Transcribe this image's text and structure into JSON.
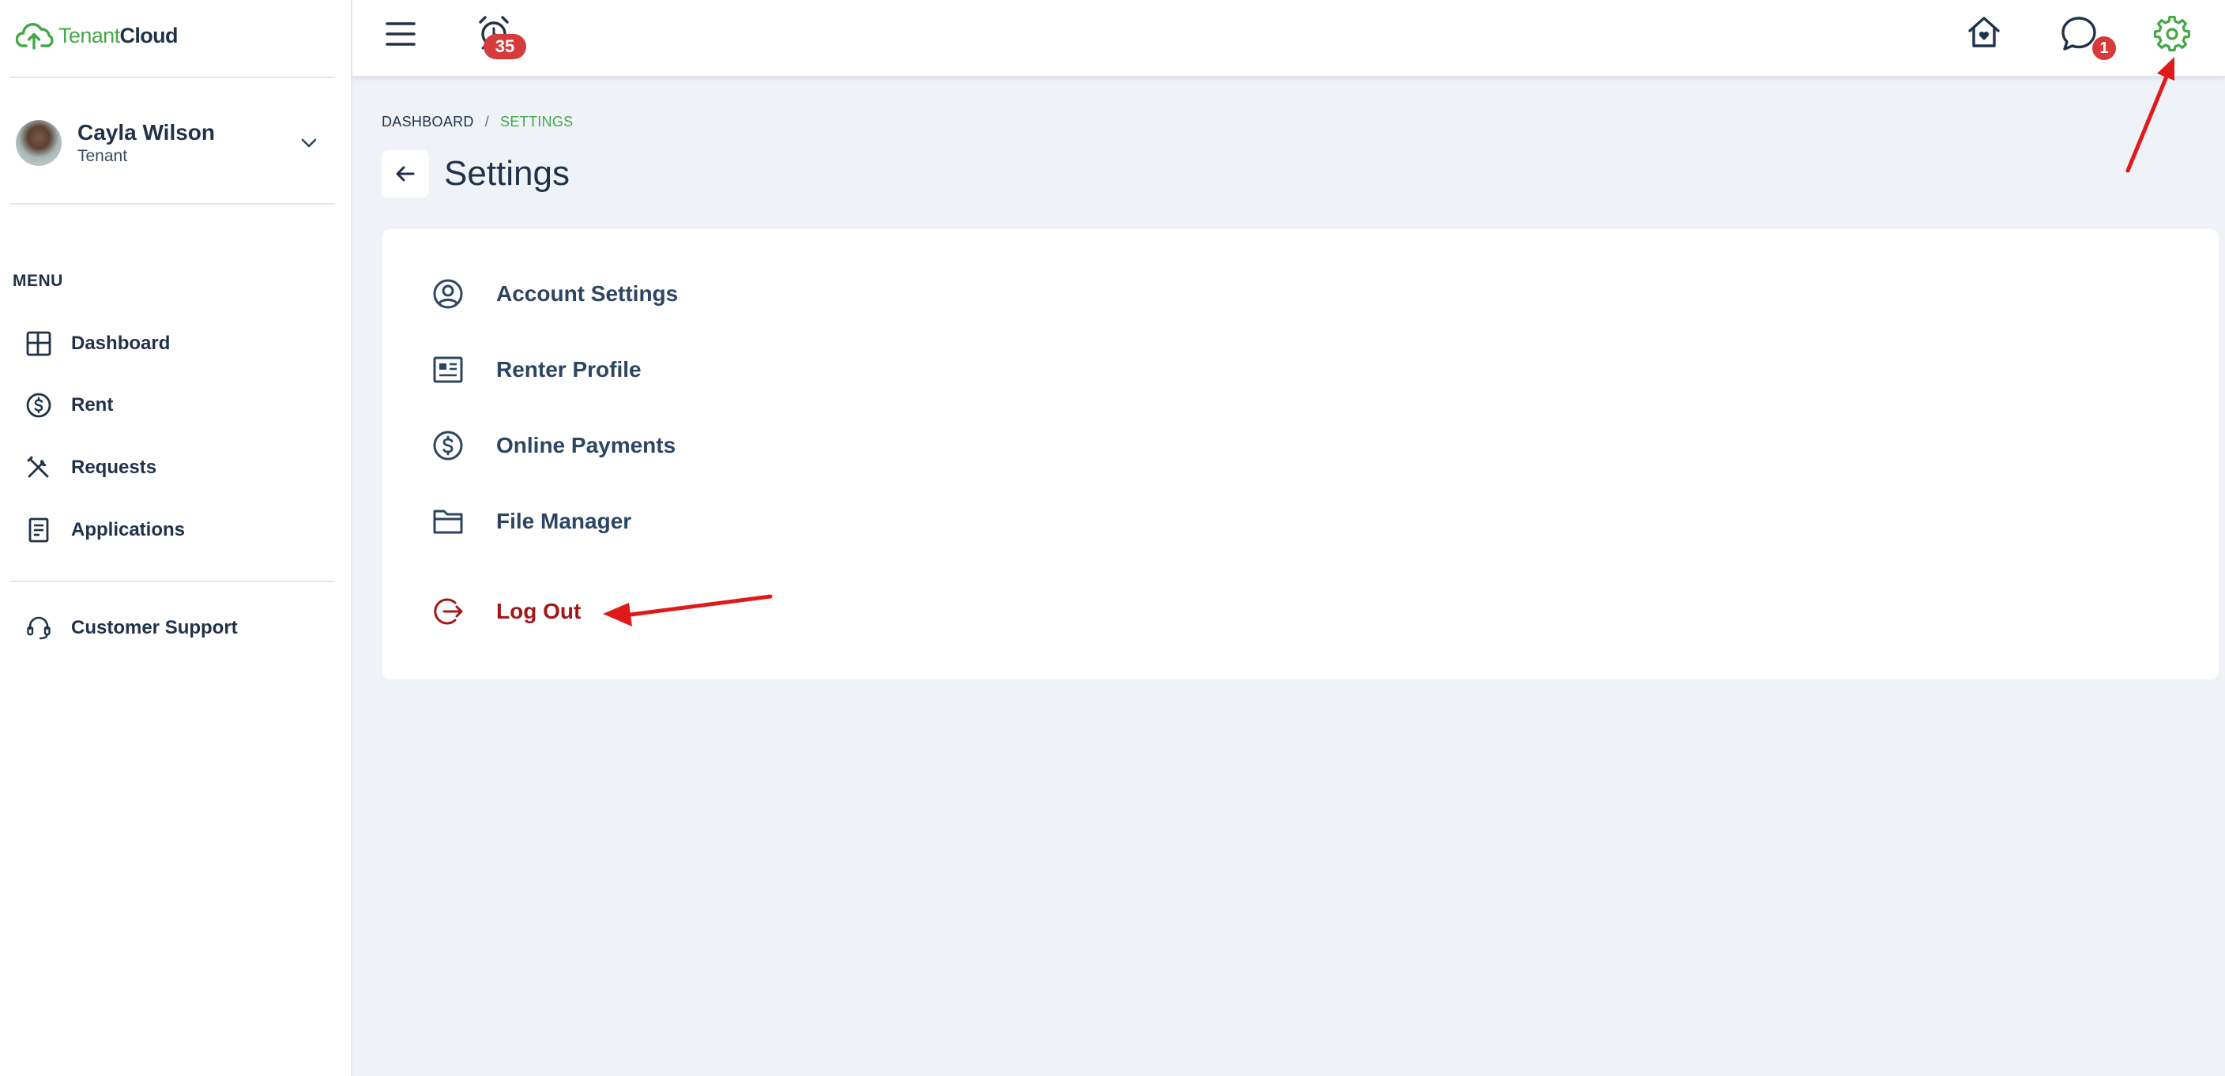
{
  "app": {
    "logo_part1": "Tenant",
    "logo_part2": "Cloud"
  },
  "user": {
    "name": "Cayla Wilson",
    "role": "Tenant"
  },
  "sidebar": {
    "menu_heading": "MENU",
    "items": [
      {
        "label": "Dashboard",
        "icon": "dashboard-grid-icon"
      },
      {
        "label": "Rent",
        "icon": "dollar-circle-icon"
      },
      {
        "label": "Requests",
        "icon": "tools-icon"
      },
      {
        "label": "Applications",
        "icon": "document-icon"
      }
    ],
    "support": {
      "label": "Customer Support",
      "icon": "headset-icon"
    }
  },
  "topbar": {
    "alarm_count": "35",
    "messages_count": "1",
    "icons": [
      "menu-icon",
      "alarm-clock-icon",
      "home-heart-icon",
      "chat-icon",
      "gear-icon"
    ]
  },
  "breadcrumb": {
    "home": "DASHBOARD",
    "separator": "/",
    "current": "SETTINGS"
  },
  "page": {
    "title": "Settings"
  },
  "settings_menu": {
    "items": [
      {
        "label": "Account Settings",
        "icon": "user-circle-icon"
      },
      {
        "label": "Renter Profile",
        "icon": "profile-card-icon"
      },
      {
        "label": "Online Payments",
        "icon": "dollar-circle-icon"
      },
      {
        "label": "File Manager",
        "icon": "folder-icon"
      }
    ],
    "logout": {
      "label": "Log Out",
      "icon": "logout-icon"
    }
  },
  "colors": {
    "brand_green": "#43a847",
    "navy": "#1f3249",
    "danger_red": "#a11818",
    "badge_red": "#d63a3a",
    "annotation_red": "#e01a1a",
    "background": "#eff2f7"
  }
}
